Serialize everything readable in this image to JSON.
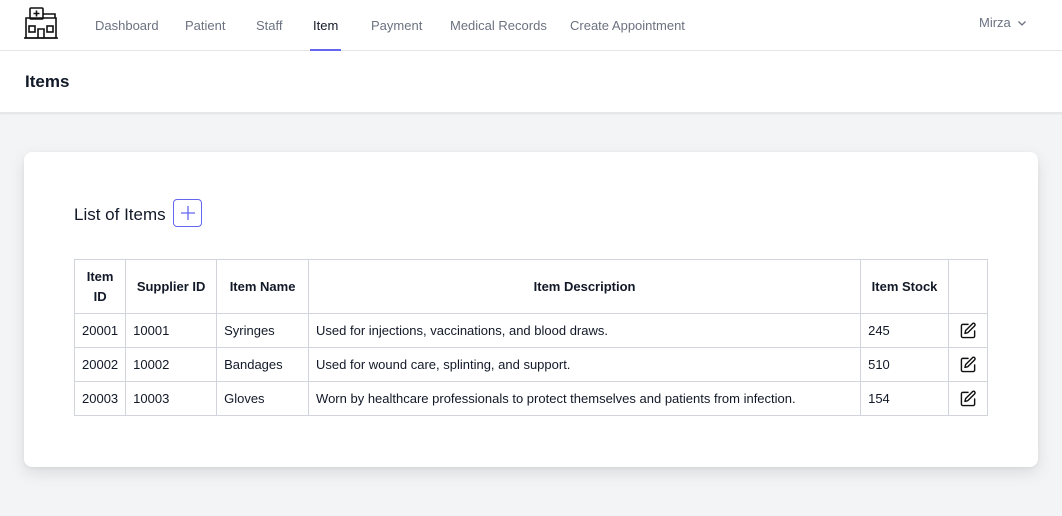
{
  "nav": {
    "items": [
      {
        "label": "Dashboard",
        "active": false
      },
      {
        "label": "Patient",
        "active": false
      },
      {
        "label": "Staff",
        "active": false
      },
      {
        "label": "Item",
        "active": true
      },
      {
        "label": "Payment",
        "active": false
      },
      {
        "label": "Medical Records",
        "active": false
      },
      {
        "label": "Create Appointment",
        "active": false
      }
    ],
    "user": "Mirza",
    "logo_icon": "hospital-icon",
    "user_menu_icon": "chevron-down-icon"
  },
  "page": {
    "title": "Items"
  },
  "card": {
    "title": "List of Items",
    "add_icon": "plus-icon"
  },
  "table": {
    "headers": {
      "item_id": "Item ID",
      "supplier_id": "Supplier ID",
      "item_name": "Item Name",
      "item_description": "Item Description",
      "item_stock": "Item Stock"
    },
    "rows": [
      {
        "item_id": "20001",
        "supplier_id": "10001",
        "item_name": "Syringes",
        "item_description": "Used for injections, vaccinations, and blood draws.",
        "item_stock": "245"
      },
      {
        "item_id": "20002",
        "supplier_id": "10002",
        "item_name": "Bandages",
        "item_description": "Used for wound care, splinting, and support.",
        "item_stock": "510"
      },
      {
        "item_id": "20003",
        "supplier_id": "10003",
        "item_name": "Gloves",
        "item_description": "Worn by healthcare professionals to protect themselves and patients from infection.",
        "item_stock": "154"
      }
    ],
    "row_action_icon": "edit-icon"
  },
  "colors": {
    "accent": "#6366f1",
    "background": "#f3f4f6",
    "nav_text": "#6b7280",
    "border": "#d1d5db"
  }
}
